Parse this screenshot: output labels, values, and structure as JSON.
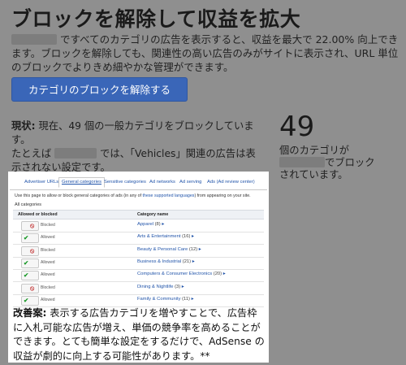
{
  "title": "ブロックを解除して収益を拡大",
  "intro": {
    "before_redaction": "",
    "after_redaction": " ですべてのカテゴリの広告を表示すると、収益を最大で 22.00% 向上できます。ブロックを解除しても、関連性の高い広告のみがサイトに表示され、URL 単位のブロックでよりきめ細やかな管理ができます。"
  },
  "cta_button": "カテゴリのブロックを解除する",
  "status": {
    "label": "現状:",
    "line1": " 現在、49 個の一般カテゴリをブロックしています。",
    "line2_prefix": "たとえば ",
    "line2_suffix": " では、「Vehicles」関連の広告は表示されない設定です。"
  },
  "blocked_count": "49",
  "count_caption": {
    "line1": "個のカテゴリが",
    "line2_suffix": "でブロック",
    "line3": "されています。"
  },
  "screenshot": {
    "tabs": [
      {
        "label": "Advertiser URLs",
        "active": false
      },
      {
        "label": "General categories",
        "active": true
      },
      {
        "label": "Sensitive categories",
        "active": false
      },
      {
        "label": "Ad networks",
        "active": false
      },
      {
        "label": "Ad serving",
        "active": false
      },
      {
        "label": "Ads (Ad review center)",
        "active": false
      }
    ],
    "hint_text": "Use this page to allow or block general categories of ads (in any of ",
    "hint_link": "these supported languages",
    "hint_tail": ") from appearing on your site.",
    "all_categories": "All categories",
    "col_status": "Allowed or blocked",
    "col_category": "Category name",
    "rows": [
      {
        "state": "Blocked",
        "allowed": false,
        "name": "Apparel",
        "meta": "(8)"
      },
      {
        "state": "Allowed",
        "allowed": true,
        "name": "Arts & Entertainment",
        "meta": "(16)"
      },
      {
        "state": "Blocked",
        "allowed": false,
        "name": "Beauty & Personal Care",
        "meta": "(12)"
      },
      {
        "state": "Allowed",
        "allowed": true,
        "name": "Business & Industrial",
        "meta": "(21)"
      },
      {
        "state": "Allowed",
        "allowed": true,
        "name": "Computers & Consumer Electronics",
        "meta": "(20)"
      },
      {
        "state": "Blocked",
        "allowed": false,
        "name": "Dining & Nightlife",
        "meta": "(3)"
      },
      {
        "state": "Allowed",
        "allowed": true,
        "name": "Family & Community",
        "meta": "(11)"
      }
    ]
  },
  "improvement": {
    "label": "改善案:",
    "text": " 表示する広告カテゴリを増やすことで、広告枠に入札可能な広告が増え、単価の競争率を高めることができます。とても簡単な設定をするだけで、AdSense の収益が劇的に向上する可能性があります。**"
  }
}
